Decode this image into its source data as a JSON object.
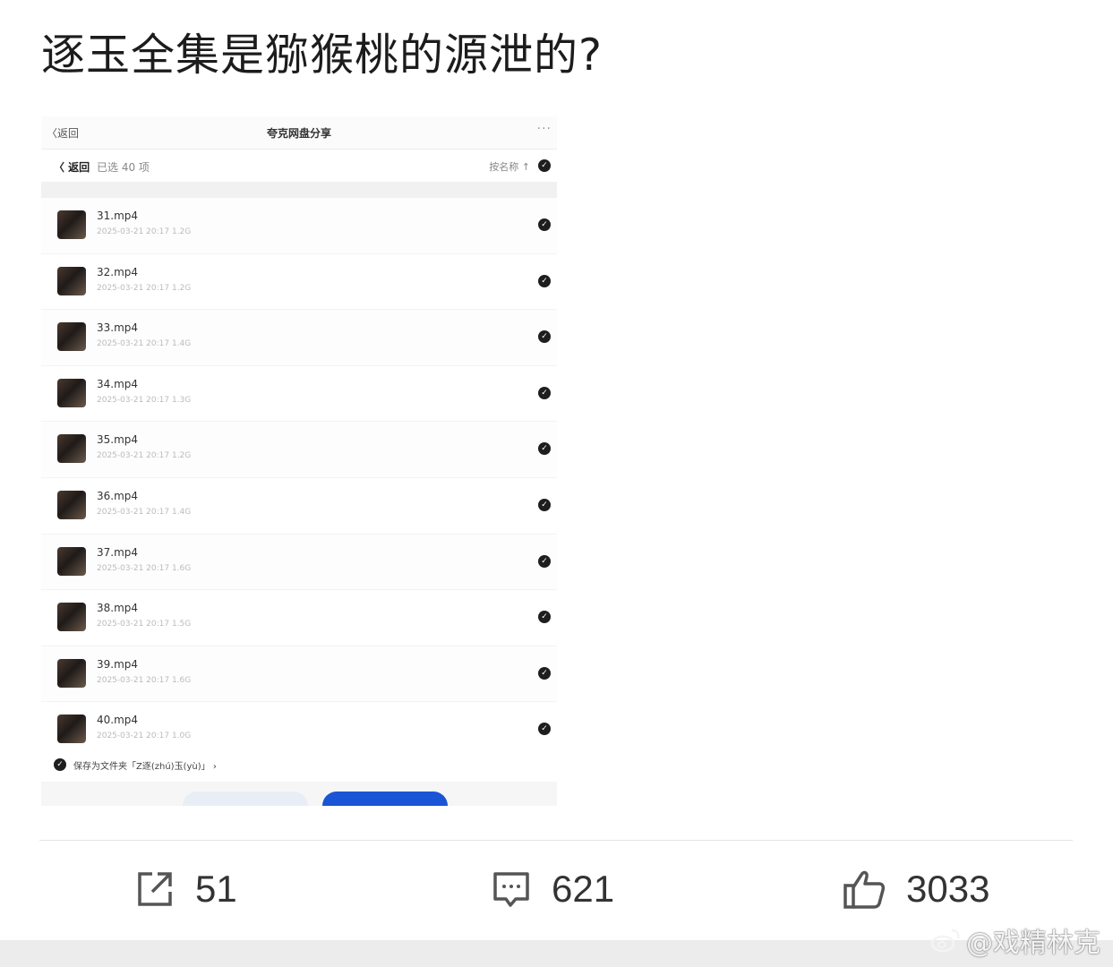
{
  "post": {
    "title": "逐玉全集是猕猴桃的源泄的?"
  },
  "screenshot": {
    "nav_back": "〈返回",
    "nav_title": "夸克网盘分享",
    "nav_more": "···",
    "selection": {
      "back": "〈 返回",
      "count": "已选 40 项",
      "sort": "按名称 ↑"
    },
    "files": [
      {
        "name": "31.mp4",
        "meta": "2025-03-21 20:17  1.2G"
      },
      {
        "name": "32.mp4",
        "meta": "2025-03-21 20:17  1.2G"
      },
      {
        "name": "33.mp4",
        "meta": "2025-03-21 20:17  1.4G"
      },
      {
        "name": "34.mp4",
        "meta": "2025-03-21 20:17  1.3G"
      },
      {
        "name": "35.mp4",
        "meta": "2025-03-21 20:17  1.2G"
      },
      {
        "name": "36.mp4",
        "meta": "2025-03-21 20:17  1.4G"
      },
      {
        "name": "37.mp4",
        "meta": "2025-03-21 20:17  1.6G"
      },
      {
        "name": "38.mp4",
        "meta": "2025-03-21 20:17  1.5G"
      },
      {
        "name": "39.mp4",
        "meta": "2025-03-21 20:17  1.6G"
      },
      {
        "name": "40.mp4",
        "meta": "2025-03-21 20:17  1.0G"
      }
    ],
    "save_to": "保存为文件夹「Z逐(zhú)玉(yù)」 ›"
  },
  "actions": {
    "share_count": "51",
    "comment_count": "621",
    "like_count": "3033"
  },
  "watermark": {
    "text": "@戏精林克"
  },
  "colors": {
    "accent": "#1a55d6",
    "check": "#1e1e1e"
  }
}
